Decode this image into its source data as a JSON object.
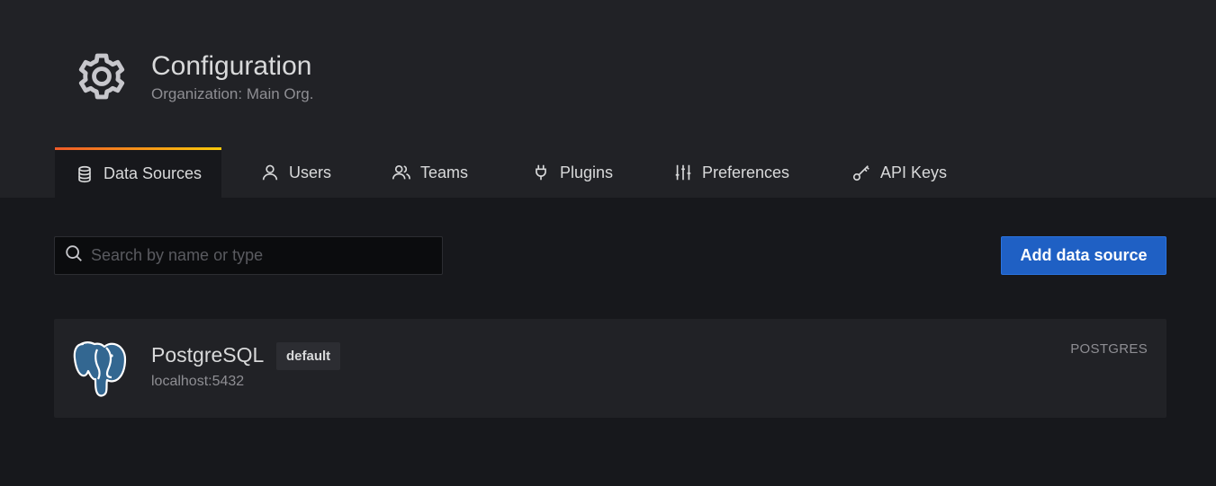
{
  "page": {
    "title": "Configuration",
    "subtitle": "Organization: Main Org.",
    "icon": "gear-icon"
  },
  "tabs": [
    {
      "label": "Data Sources",
      "icon": "database-icon",
      "active": true
    },
    {
      "label": "Users",
      "icon": "user-icon",
      "active": false
    },
    {
      "label": "Teams",
      "icon": "users-icon",
      "active": false
    },
    {
      "label": "Plugins",
      "icon": "plug-icon",
      "active": false
    },
    {
      "label": "Preferences",
      "icon": "sliders-icon",
      "active": false
    },
    {
      "label": "API Keys",
      "icon": "key-icon",
      "active": false
    }
  ],
  "toolbar": {
    "search_placeholder": "Search by name or type",
    "search_value": "",
    "add_button_label": "Add data source"
  },
  "datasources": [
    {
      "name": "PostgreSQL",
      "badge": "default",
      "url": "localhost:5432",
      "type": "POSTGRES",
      "icon": "postgresql-logo"
    }
  ],
  "colors": {
    "accent": "#1f60c4",
    "tab_gradient_start": "#f05a28",
    "tab_gradient_end": "#fbca0a",
    "header_bg": "#212226",
    "page_bg": "#17181c"
  }
}
